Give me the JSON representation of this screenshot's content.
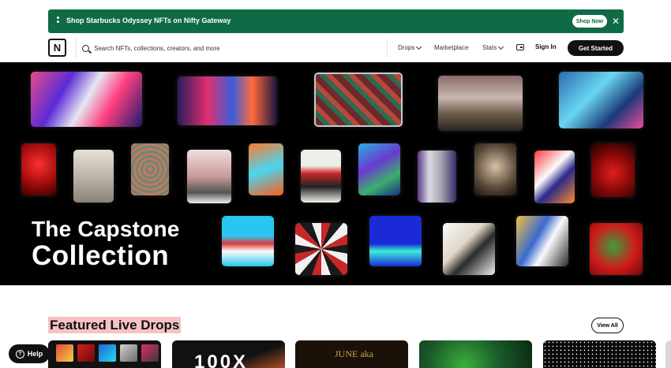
{
  "banner": {
    "text": "Shop Starbucks Odyssey NFTs on Nifty Gateway",
    "shop_now": "Shop Now",
    "close": "✕",
    "color": "#0e6b45"
  },
  "nav": {
    "logo": "N",
    "search_placeholder": "Search NFTs, collections, creators, and more",
    "drops": "Drops",
    "marketplace": "Marketplace",
    "stats": "Stats",
    "sign_in": "Sign In",
    "get_started": "Get Started"
  },
  "hero": {
    "title_line1": "The Capstone",
    "title_line2": "Collection",
    "background": "#000000"
  },
  "featured": {
    "title": "Featured Live Drops",
    "view_all": "View All",
    "highlight_color": "#f6c2c4",
    "card2_text": "100X",
    "card3_text": "JUNE aka"
  },
  "help": {
    "label": "Help",
    "icon": "?"
  }
}
